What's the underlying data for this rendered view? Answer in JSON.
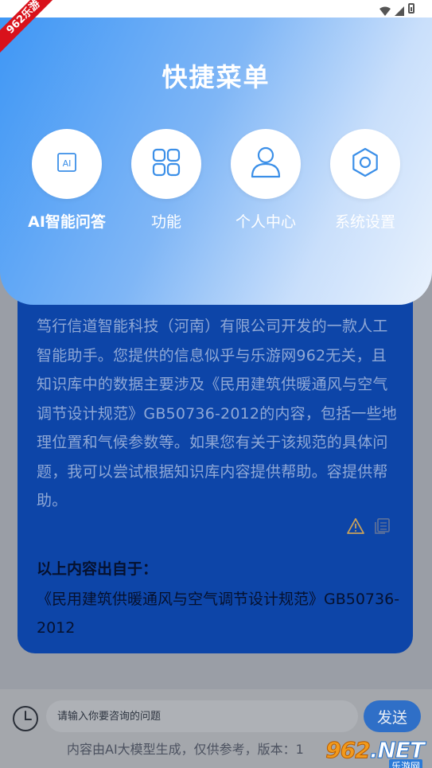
{
  "watermark": {
    "ribbon": "962乐游",
    "logo_number": "962",
    "logo_suffix": ".NET",
    "logo_sub": "乐游网"
  },
  "quick_menu": {
    "title": "快捷菜单",
    "items": [
      {
        "label": "AI智能问答",
        "icon": "ai-icon"
      },
      {
        "label": "功能",
        "icon": "grid-icon"
      },
      {
        "label": "个人中心",
        "icon": "user-icon"
      },
      {
        "label": "系统设置",
        "icon": "gear-icon"
      }
    ]
  },
  "answer": {
    "text": "笃行信道智能科技（河南）有限公司开发的一款人工智能助手。您提供的信息似乎与乐游网962无关，且知识库中的数据主要涉及《民用建筑供暖通风与空气调节设计规范》GB50736-2012的内容，包括一些地理位置和气候参数等。如果您有关于该规范的具体问题，我可以尝试根据知识库内容提供帮助。容提供帮助。",
    "source_title": "以上内容出自于：",
    "source_text": "《民用建筑供暖通风与空气调节设计规范》GB50736-2012"
  },
  "input_bar": {
    "placeholder": "请输入你要咨询的问题",
    "send_label": "发送",
    "disclaimer": "内容由AI大模型生成，仅供参考，版本：1"
  },
  "colors": {
    "menu_gradient_start": "#3f97f5",
    "menu_gradient_end": "#e9f2fd",
    "answer_card": "#0d45a8",
    "send_button": "#2f6fc7",
    "icon_accent": "#3b8fe8"
  }
}
